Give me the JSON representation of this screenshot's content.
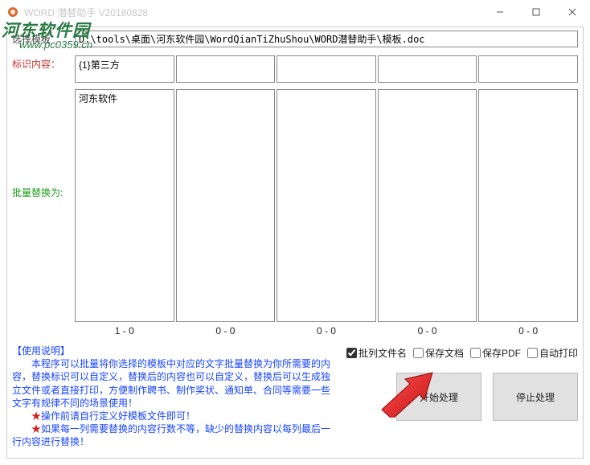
{
  "window": {
    "title": "WORD 潜替助手 V20180828"
  },
  "watermark": {
    "line1": "河东软件园",
    "line2": "www.pc0359.cn"
  },
  "labels": {
    "select_template": "选择模板",
    "identify_content": "标识内容：",
    "batch_replace": "批量替换为:"
  },
  "template_path": "D:\\tools\\桌面\\河东软件园\\WordQianTiZhuShou\\WORD潜替助手\\模板.doc",
  "identify_cells": [
    "{1}第三方",
    "",
    "",
    "",
    ""
  ],
  "replace_columns": [
    {
      "content": "河东软件",
      "stat": "1 - 0"
    },
    {
      "content": "",
      "stat": "0 - 0"
    },
    {
      "content": "",
      "stat": "0 - 0"
    },
    {
      "content": "",
      "stat": "0 - 0"
    },
    {
      "content": "",
      "stat": "0 - 0"
    }
  ],
  "instructions": {
    "title": "【使用说明】",
    "p1_indent": "　　",
    "p1": "本程序可以批量将你选择的模板中对应的文字批量替换为你所需要的内容，替换标识可以自定义，替换后的内容也可以自定义，替换后可以生成独立文件或者直接打印，方便制作聘书、制作奖状、通知单、合同等需要一些文字有规律不同的场景使用！",
    "star2": "★",
    "p2": "操作前请自行定义好模板文件即可！",
    "star3": "★",
    "p3": "如果每一列需要替换的内容行数不等，缺少的替换内容以每列最后一行内容进行替换！"
  },
  "checkboxes": {
    "batch_filename": {
      "label": "批列文件名",
      "checked": true
    },
    "save_doc": {
      "label": "保存文档",
      "checked": false
    },
    "save_pdf": {
      "label": "保存PDF",
      "checked": false
    },
    "auto_print": {
      "label": "自动打印",
      "checked": false
    }
  },
  "buttons": {
    "start": "开始处理",
    "stop": "停止处理"
  }
}
